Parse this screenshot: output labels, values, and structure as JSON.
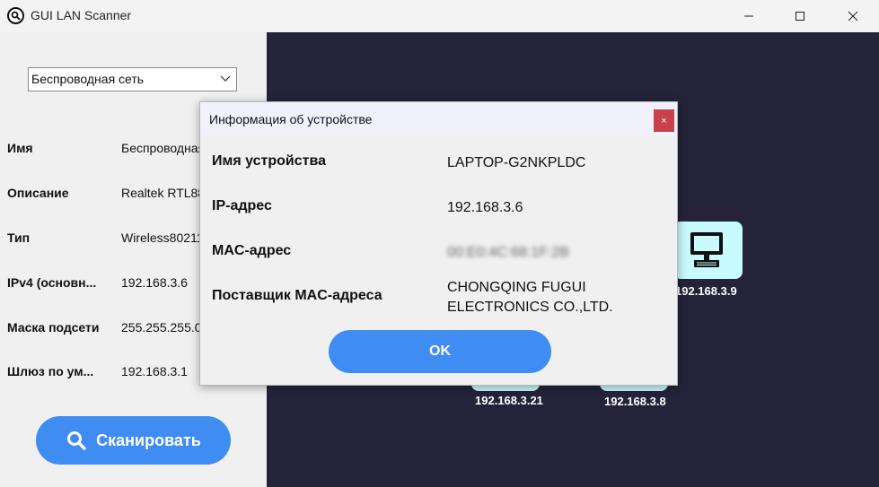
{
  "window": {
    "title": "GUI LAN Scanner",
    "icons": {
      "app": "magnifier-app-icon",
      "minimize": "minimize-icon",
      "maximize": "maximize-icon",
      "close": "close-icon"
    }
  },
  "adapter_select": {
    "value": "Беспроводная сеть"
  },
  "adapter_info": [
    {
      "label": "Имя",
      "value": "Беспроводная"
    },
    {
      "label": "Описание",
      "value": "Realtek RTL88"
    },
    {
      "label": "Тип",
      "value": "Wireless80211"
    },
    {
      "label": "IPv4 (основн...",
      "value": "192.168.3.6"
    },
    {
      "label": "Маска подсети",
      "value": "255.255.255.0"
    },
    {
      "label": "Шлюз по ум...",
      "value": "192.168.3.1"
    }
  ],
  "scan_button": {
    "label": "Сканировать",
    "icon": "search-icon"
  },
  "devices": [
    {
      "ip": "192.168.3.9",
      "icon": "monitor-icon"
    },
    {
      "ip": "192.168.3.21"
    },
    {
      "ip": "192.168.3.8"
    }
  ],
  "dialog": {
    "title": "Информация об устройстве",
    "close_label": "×",
    "rows": [
      {
        "label": "Имя устройства",
        "value": "LAPTOP-G2NKPLDC"
      },
      {
        "label": "IP-адрес",
        "value": "192.168.3.6"
      },
      {
        "label": "MAC-адрес",
        "value": "00:E0:4C:68:1F:2B"
      },
      {
        "label": "Поставщик MAC-адреса",
        "value_line1": "CHONGQING FUGUI",
        "value_line2": "ELECTRONICS CO.,LTD."
      }
    ],
    "ok_label": "OK"
  },
  "colors": {
    "accent_blue": "#3f8cf2",
    "dark_panel": "#24233a",
    "device_card": "#c8fbff",
    "dialog_close": "#c8414b"
  }
}
